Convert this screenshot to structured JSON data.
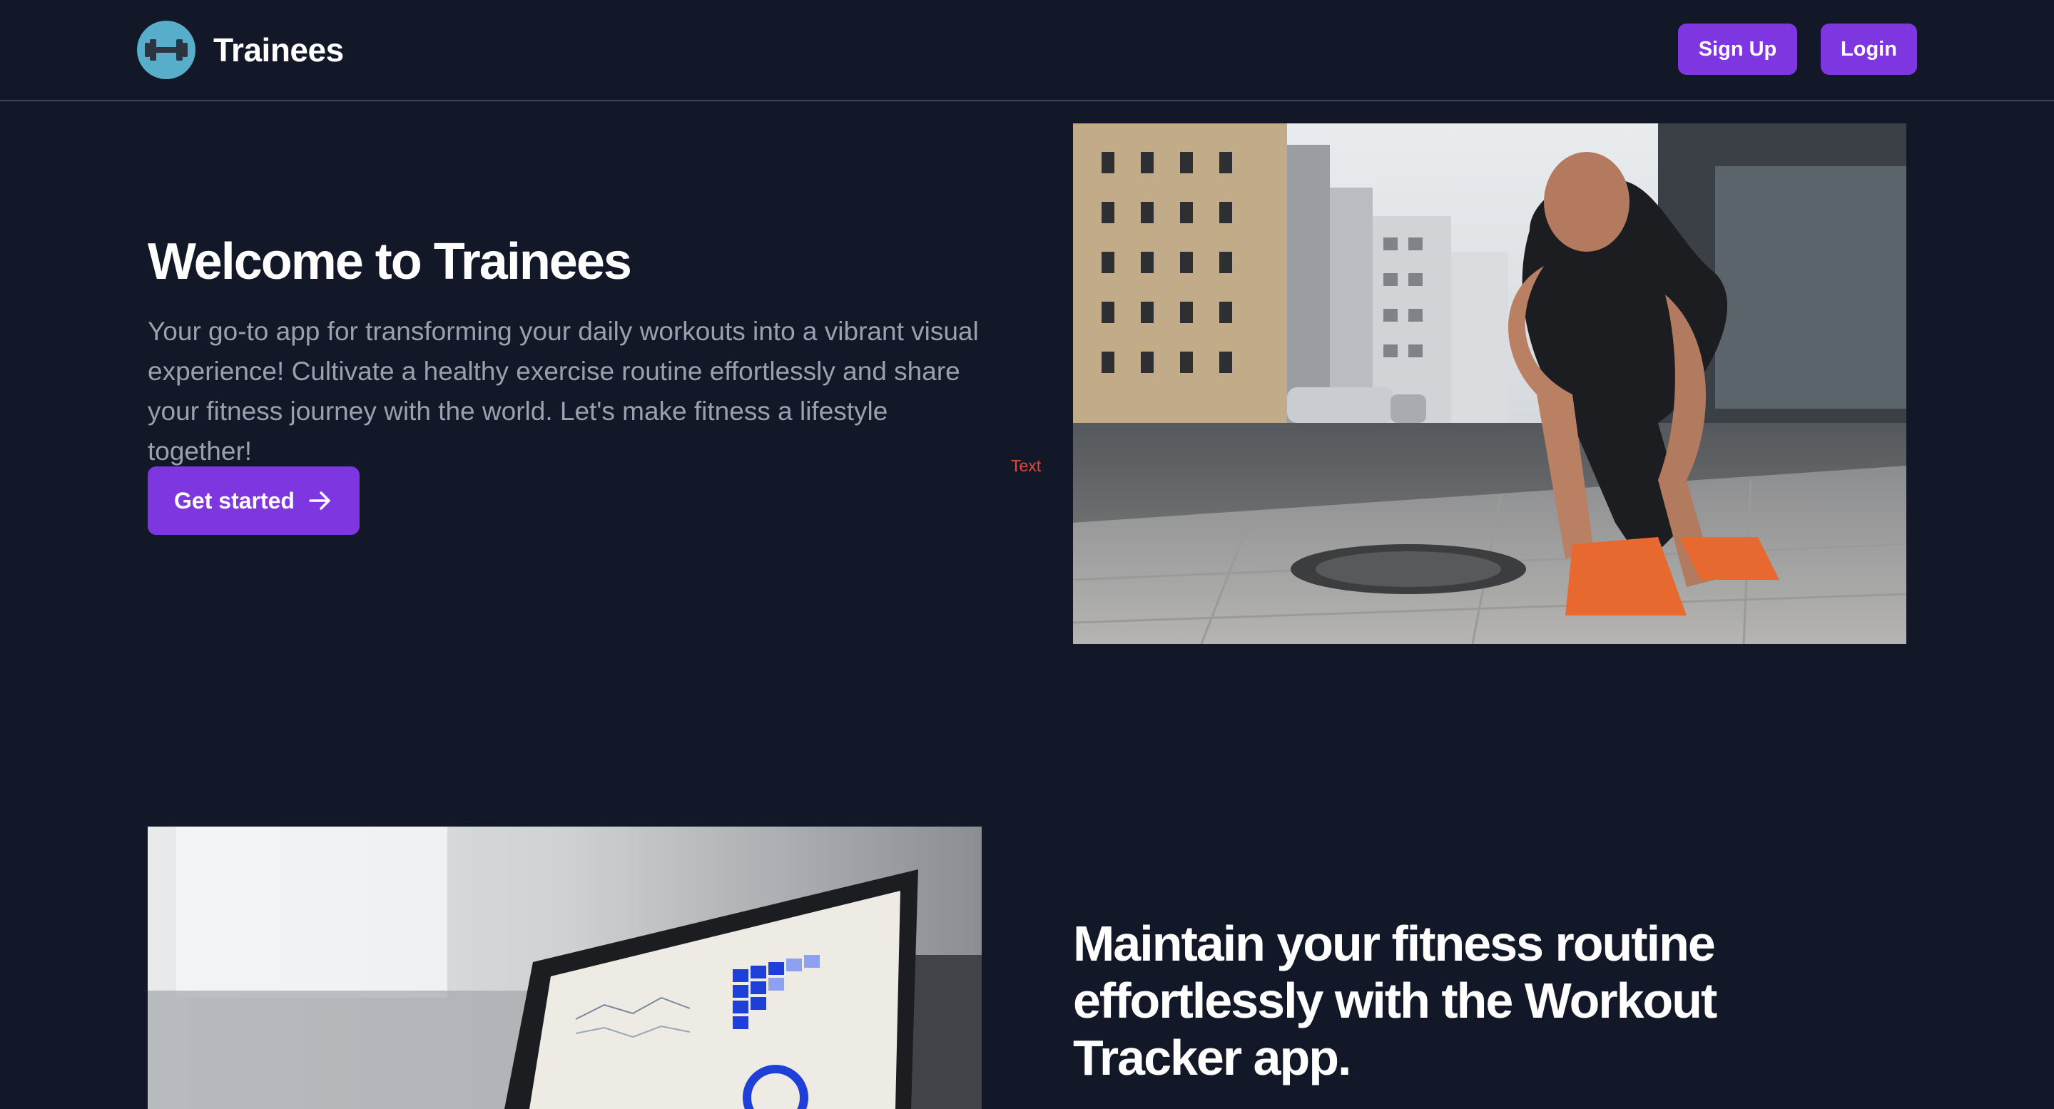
{
  "header": {
    "brand_name": "Trainees",
    "logo_icon": "dumbbell-icon",
    "signup_label": "Sign Up",
    "login_label": "Login"
  },
  "hero": {
    "title": "Welcome to Trainees",
    "description": "Your go-to app for transforming your daily workouts into a vibrant visual experience! Cultivate a healthy exercise routine effortlessly and share your fitness journey with the world. Let's make fitness a lifestyle together!",
    "cta_label": "Get started",
    "cta_icon": "arrow-right-icon",
    "stray_label": "Text",
    "image": "runner-tying-shoe-photo"
  },
  "feature": {
    "title": "Maintain your fitness routine effortlessly with the Workout Tracker app.",
    "image": "laptop-dashboard-photo"
  },
  "colors": {
    "background": "#131828",
    "accent": "#7d36e0",
    "logo": "#56aecb",
    "muted_text": "#9ca0ad",
    "stray_text": "#e0493a"
  }
}
